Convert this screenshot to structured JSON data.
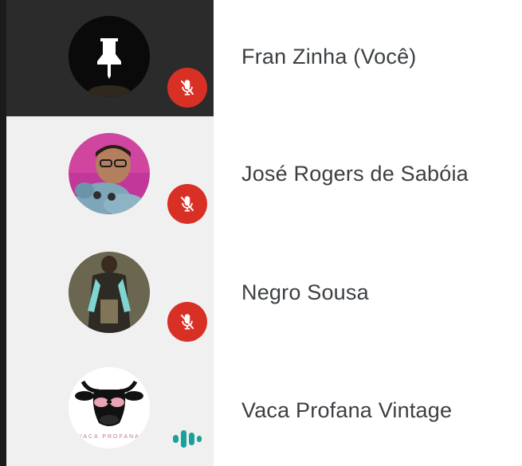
{
  "participants": [
    {
      "name": "Fran Zinha (Você)",
      "avatar_icon": "pin-icon",
      "status_icon": "mic-off-icon",
      "is_self": true
    },
    {
      "name": "José Rogers de Sabóia",
      "avatar_icon": "person-photo-avatar",
      "status_icon": "mic-off-icon"
    },
    {
      "name": "Negro Sousa",
      "avatar_icon": "person-photo-avatar",
      "status_icon": "mic-off-icon"
    },
    {
      "name": "Vaca Profana Vintage",
      "avatar_icon": "cow-logo-avatar",
      "avatar_caption": "VACA PROFANA",
      "status_icon": "audio-speaking-icon"
    }
  ],
  "colors": {
    "muted_badge": "#d93025",
    "speaking_indicator": "#1aa29a",
    "self_tile_bg": "#2b2b2b",
    "tile_bg": "#f0f0f0",
    "name_text": "#3c4043"
  }
}
